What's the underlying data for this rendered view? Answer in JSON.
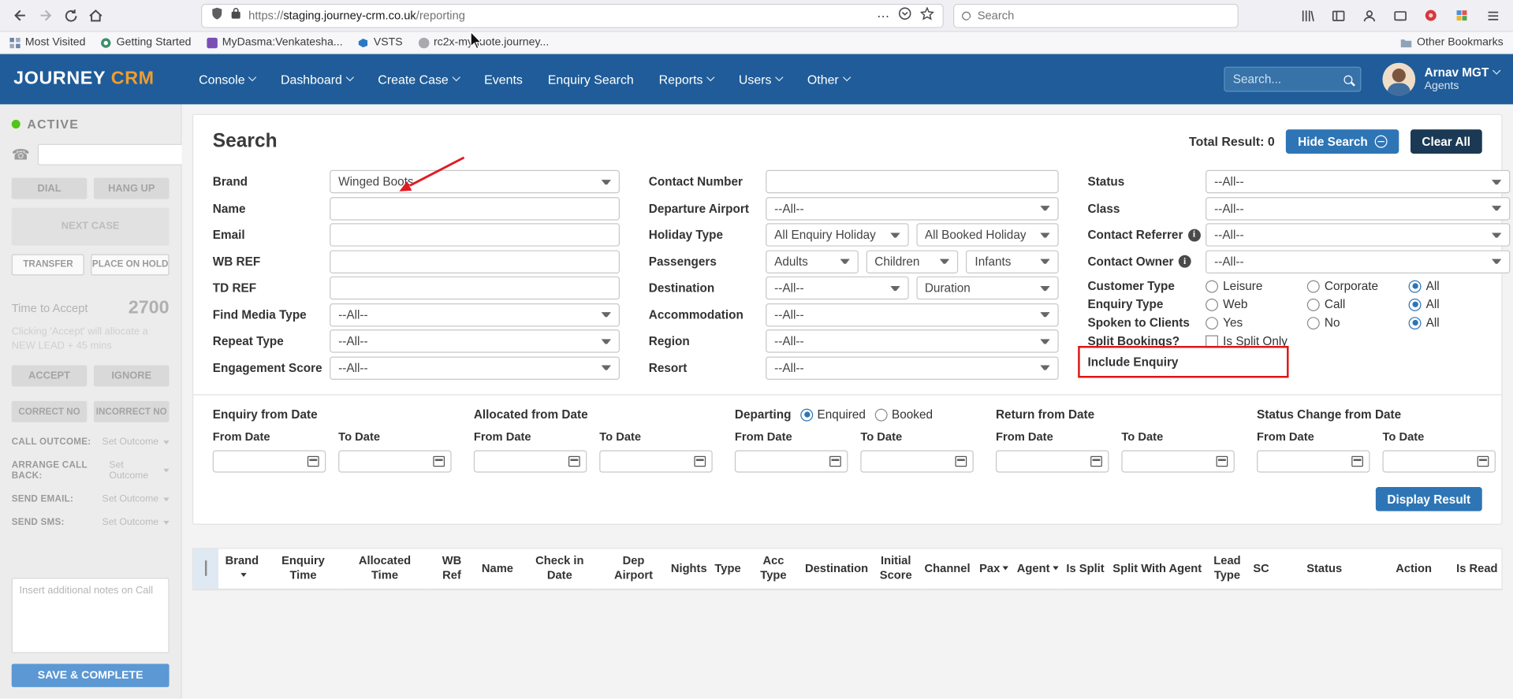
{
  "browser": {
    "url": {
      "prefix": "https://",
      "domain": "staging.journey-crm.co.uk",
      "path": "/reporting"
    },
    "search_placeholder": "Search",
    "bookmarks": [
      {
        "label": "Most Visited"
      },
      {
        "label": "Getting Started"
      },
      {
        "label": "MyDasma:Venkatesha..."
      },
      {
        "label": "VSTS"
      },
      {
        "label": "rc2x-myquote.journey..."
      }
    ],
    "other_bookmarks": "Other Bookmarks"
  },
  "header": {
    "logo_main": "JOURNEY",
    "logo_accent": "CRM",
    "nav": [
      {
        "label": "Console"
      },
      {
        "label": "Dashboard"
      },
      {
        "label": "Create Case"
      },
      {
        "label": "Events"
      },
      {
        "label": "Enquiry Search"
      },
      {
        "label": "Reports"
      },
      {
        "label": "Users"
      },
      {
        "label": "Other"
      }
    ],
    "search_placeholder": "Search...",
    "user": {
      "name": "Arnav MGT",
      "role": "Agents"
    }
  },
  "sidebar": {
    "status": "ACTIVE",
    "dial": "DIAL",
    "hang_up": "HANG UP",
    "next_case": "NEXT CASE",
    "transfer": "TRANSFER",
    "place_on_hold": "PLACE ON HOLD",
    "time_to_accept_label": "Time to Accept",
    "time_to_accept_value": "2700",
    "accept_hint": "Clicking 'Accept' will allocate a NEW LEAD + 45 mins",
    "accept": "ACCEPT",
    "ignore": "IGNORE",
    "correct_no": "CORRECT NO",
    "incorrect_no": "INCORRECT NO",
    "outcomes": [
      {
        "label": "CALL OUTCOME:",
        "value": "Set Outcome"
      },
      {
        "label": "ARRANGE CALL BACK:",
        "value": "Set Outcome"
      },
      {
        "label": "SEND EMAIL:",
        "value": "Set Outcome"
      },
      {
        "label": "SEND SMS:",
        "value": "Set Outcome"
      }
    ],
    "notes_placeholder": "Insert additional notes on Call",
    "save_complete": "SAVE & COMPLETE"
  },
  "search_panel": {
    "title": "Search",
    "total_label": "Total Result:",
    "total_value": "0",
    "hide_search": "Hide Search",
    "clear_all": "Clear All",
    "col1": [
      {
        "label": "Brand",
        "value": "Winged Boots"
      },
      {
        "label": "Name",
        "value": ""
      },
      {
        "label": "Email",
        "value": ""
      },
      {
        "label": "WB REF",
        "value": ""
      },
      {
        "label": "TD REF",
        "value": ""
      },
      {
        "label": "Find Media Type",
        "value": "--All--"
      },
      {
        "label": "Repeat Type",
        "value": "--All--"
      },
      {
        "label": "Engagement Score",
        "value": "--All--"
      }
    ],
    "col2": [
      {
        "label": "Contact Number",
        "value": ""
      },
      {
        "label": "Departure Airport",
        "value": "--All--"
      },
      {
        "label": "Holiday Type",
        "value1": "All Enquiry Holiday",
        "value2": "All Booked Holiday"
      },
      {
        "label": "Passengers",
        "value1": "Adults",
        "value2": "Children",
        "value3": "Infants"
      },
      {
        "label": "Destination",
        "value1": "--All--",
        "value2": "Duration"
      },
      {
        "label": "Accommodation",
        "value": "--All--"
      },
      {
        "label": "Region",
        "value": "--All--"
      },
      {
        "label": "Resort",
        "value": "--All--"
      }
    ],
    "col3": [
      {
        "label": "Status",
        "value": "--All--"
      },
      {
        "label": "Class",
        "value": "--All--"
      },
      {
        "label": "Contact Referrer",
        "value": "--All--"
      },
      {
        "label": "Contact Owner",
        "value": "--All--"
      },
      {
        "label": "Customer Type",
        "options": [
          "Leisure",
          "Corporate",
          "All"
        ],
        "selected": "All"
      },
      {
        "label": "Enquiry Type",
        "options": [
          "Web",
          "Call",
          "All"
        ],
        "selected": "All"
      },
      {
        "label": "Spoken to Clients",
        "options": [
          "Yes",
          "No",
          "All"
        ],
        "selected": "All"
      },
      {
        "label": "Split Bookings?",
        "checkbox": "Is Split Only"
      },
      {
        "label": "Include Enquiry"
      }
    ],
    "dates": {
      "from_label": "From Date",
      "to_label": "To Date",
      "groups": [
        {
          "title": "Enquiry from Date"
        },
        {
          "title": "Allocated from Date"
        },
        {
          "title": "Departing",
          "radio1": "Enquired",
          "radio2": "Booked",
          "selected": "Enquired"
        },
        {
          "title": "Return from Date"
        },
        {
          "title": "Status Change from Date"
        }
      ]
    },
    "display_result": "Display Result"
  },
  "table": {
    "columns": [
      {
        "label": ""
      },
      {
        "label": "Brand",
        "sort": true
      },
      {
        "label": "Enquiry Time"
      },
      {
        "label": "Allocated Time"
      },
      {
        "label": "WB Ref"
      },
      {
        "label": "Name"
      },
      {
        "label": "Check in Date"
      },
      {
        "label": "Dep Airport"
      },
      {
        "label": "Nights"
      },
      {
        "label": "Type"
      },
      {
        "label": "Acc Type"
      },
      {
        "label": "Destination"
      },
      {
        "label": "Initial Score"
      },
      {
        "label": "Channel"
      },
      {
        "label": "Pax",
        "sort": true
      },
      {
        "label": "Agent",
        "sort": true
      },
      {
        "label": "Is Split"
      },
      {
        "label": "Split With Agent"
      },
      {
        "label": "Lead Type"
      },
      {
        "label": "SC"
      },
      {
        "label": "Status"
      },
      {
        "label": "Action"
      },
      {
        "label": "Is Read"
      }
    ],
    "rows": []
  },
  "colors": {
    "header_blue": "#1f5c99",
    "accent_orange": "#f09d2e",
    "button_blue": "#2e75b6",
    "dark_navy": "#1b3954",
    "annotation_red": "#dd1414"
  }
}
